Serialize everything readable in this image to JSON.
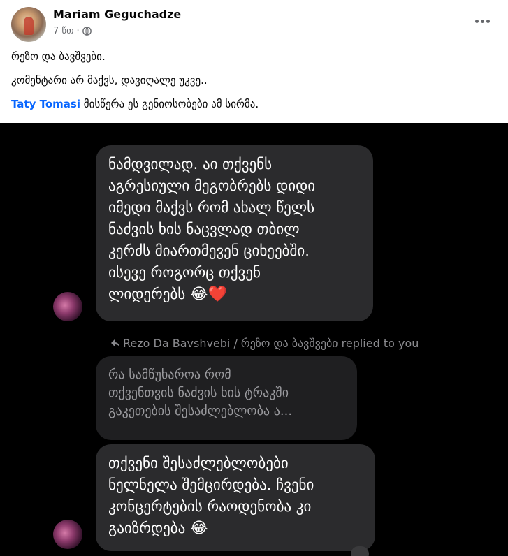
{
  "post": {
    "author": "Mariam Geguchadze",
    "time": "7 წთ",
    "separator": "·",
    "lines": [
      "რეზო და ბავშვები.",
      "კომენტარი არ მაქვს, დავიღალე უკვე.."
    ],
    "mention": "Taty Tomasi",
    "mention_suffix": " მისწერა ეს გენიოსობები ამ სირმა."
  },
  "chat": {
    "message1_lines": [
      "ნამდვილად. აი თქვენს",
      "აგრესიული მეგობრებს დიდი",
      "იმედი მაქვს რომ ახალ წელს",
      "ნაძვის ხის ნაცვლად თბილ",
      "კერძს მიართმევენ ციხეებში.",
      "ისევე როგორც თქვენ",
      "ლიდერებს"
    ],
    "message1_emojis": [
      "😂",
      "❤️"
    ],
    "replied_label": "Rezo Da Bavshvebi / რეზო და ბავშვები replied to you",
    "quoted_lines": [
      "რა სამწუხაროა რომ",
      "თქვენთვის ნაძვის ხის ტრაკში",
      "გაკეთების შესაძლებლობა ა..."
    ],
    "message2_lines": [
      "თქვენი შესაძლებლობები",
      "ნელნელა შემცირდება. ჩვენი",
      "კონცერტების რაოდენობა კი",
      "გაიზრდება"
    ],
    "message2_emoji": "😂"
  },
  "icons": {
    "more": "more-horizontal-icon",
    "audience": "globe-icon",
    "reply": "reply-arrow-icon"
  },
  "colors": {
    "mention": "#0866ff",
    "chat_bg": "#000000",
    "bubble": "#2b2b2d",
    "quoted_bubble": "#1f1f21"
  }
}
